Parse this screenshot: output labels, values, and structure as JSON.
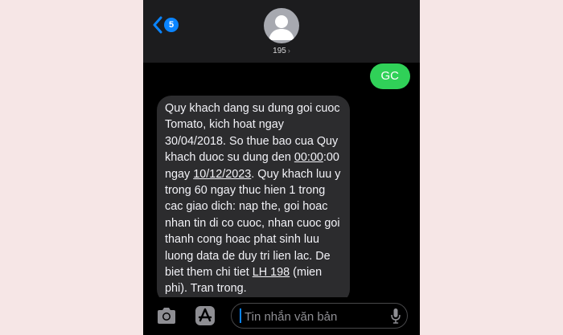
{
  "nav": {
    "back_badge": "5",
    "contact_name": "195",
    "contact_chevron": "›"
  },
  "messages": {
    "sent_text": "GC",
    "received": {
      "part1": "Quy khach dang su dung goi cuoc Tomato, kich hoat ngay 30/04/2018. So thue bao cua Quy khach duoc su dung den ",
      "time": "00:00",
      "part2": ":00 ngay ",
      "date": "10/12/2023",
      "part3": ". Quy khach luu y trong 60 ngay thuc hien 1 trong cac giao dich: nap the, goi hoac nhan tin di co cuoc, nhan cuoc goi thanh cong hoac phat sinh luu luong data de duy tri lien lac. De biet them chi tiet ",
      "hotline": "LH 198",
      "part4": " (mien phi). Tran trong."
    }
  },
  "composer": {
    "placeholder": "Tin nhắn văn bản"
  },
  "colors": {
    "sent_bubble": "#30d158",
    "received_bubble": "#2c2c2e",
    "accent": "#0a84ff",
    "background": "#f6e6e6"
  },
  "icons": {
    "back": "chevron-left-icon",
    "camera": "camera-icon",
    "app_store": "app-store-icon",
    "microphone": "microphone-icon",
    "avatar": "person-icon"
  }
}
